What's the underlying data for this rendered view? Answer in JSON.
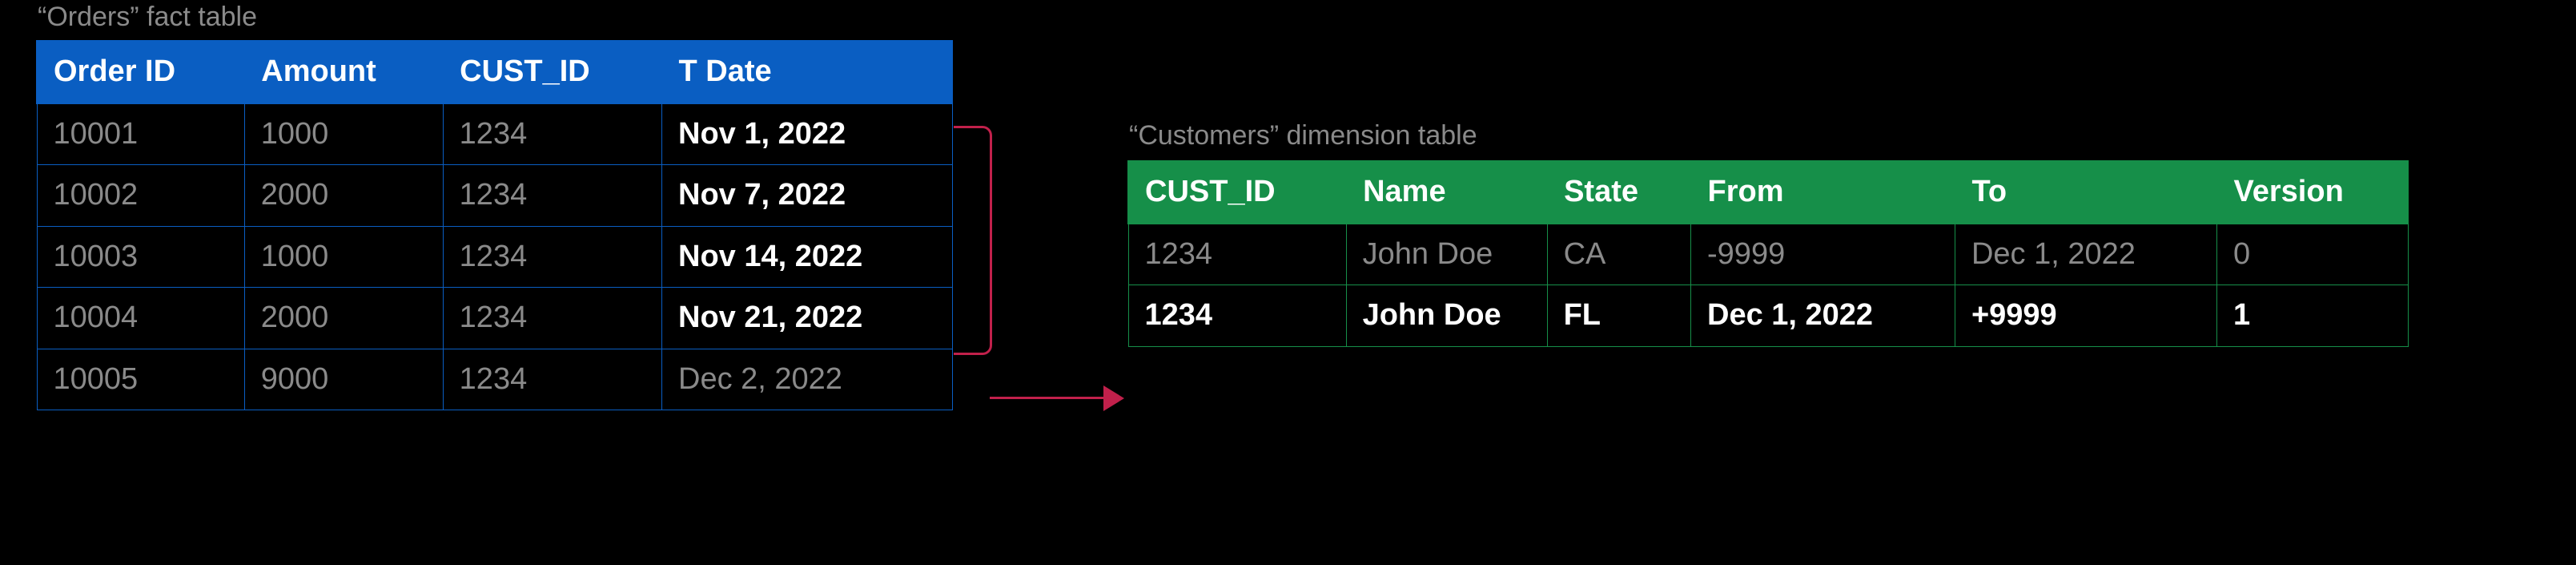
{
  "orders_table": {
    "caption": "“Orders” fact table",
    "headers": [
      "Order ID",
      "Amount",
      "CUST_ID",
      "T Date"
    ],
    "rows": [
      {
        "order_id": "10001",
        "amount": "1000",
        "cust_id": "1234",
        "tdate": "Nov 1, 2022",
        "tdate_bold": true
      },
      {
        "order_id": "10002",
        "amount": "2000",
        "cust_id": "1234",
        "tdate": "Nov 7, 2022",
        "tdate_bold": true
      },
      {
        "order_id": "10003",
        "amount": "1000",
        "cust_id": "1234",
        "tdate": "Nov 14, 2022",
        "tdate_bold": true
      },
      {
        "order_id": "10004",
        "amount": "2000",
        "cust_id": "1234",
        "tdate": "Nov 21, 2022",
        "tdate_bold": true
      },
      {
        "order_id": "10005",
        "amount": "9000",
        "cust_id": "1234",
        "tdate": "Dec 2, 2022",
        "tdate_bold": false
      }
    ]
  },
  "customers_table": {
    "caption": "“Customers” dimension table",
    "headers": [
      "CUST_ID",
      "Name",
      "State",
      "From",
      "To",
      "Version"
    ],
    "rows": [
      {
        "cust_id": "1234",
        "name": "John Doe",
        "state": "CA",
        "from": "-9999",
        "to": "Dec 1, 2022",
        "version": "0",
        "active": false
      },
      {
        "cust_id": "1234",
        "name": "John Doe",
        "state": "FL",
        "from": "Dec 1, 2022",
        "to": "+9999",
        "version": "1",
        "active": true
      }
    ]
  },
  "colors": {
    "orders_header": "#0a5ec2",
    "customers_header": "#168f49",
    "arrow": "#c1204b"
  }
}
